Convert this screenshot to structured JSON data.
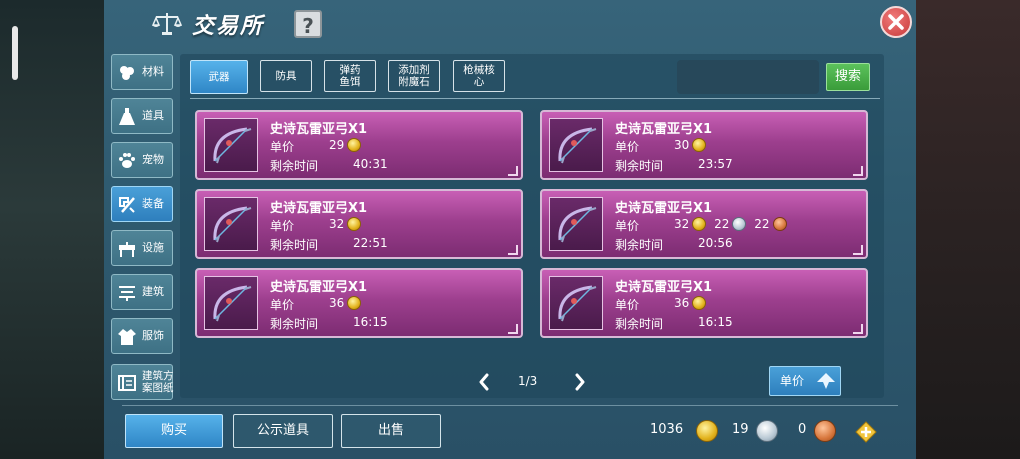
{
  "window": {
    "title": "交易所",
    "help_label": "?"
  },
  "categories": [
    {
      "label": "材料",
      "icon": "materials-icon"
    },
    {
      "label": "道具",
      "icon": "potion-icon"
    },
    {
      "label": "宠物",
      "icon": "paw-icon"
    },
    {
      "label": "装备",
      "icon": "equipment-icon",
      "active": true
    },
    {
      "label": "设施",
      "icon": "facility-icon"
    },
    {
      "label": "建筑",
      "icon": "building-icon"
    },
    {
      "label": "服饰",
      "icon": "clothing-icon"
    },
    {
      "label_line1": "建筑方",
      "label_line2": "案图纸",
      "icon": "blueprint-icon"
    }
  ],
  "subtabs": [
    {
      "label": "武器",
      "active": true
    },
    {
      "label": "防具"
    },
    {
      "label_line1": "弹药",
      "label_line2": "鱼饵"
    },
    {
      "label_line1": "添加剂",
      "label_line2": "附魔石"
    },
    {
      "label_line1": "枪械核",
      "label_line2": "心"
    }
  ],
  "search": {
    "button_label": "搜索",
    "value": ""
  },
  "field_labels": {
    "price": "单价",
    "time_left": "剩余时间"
  },
  "listings": [
    {
      "name": "史诗瓦雷亚弓X1",
      "gold": "29",
      "time_left": "40:31"
    },
    {
      "name": "史诗瓦雷亚弓X1",
      "gold": "30",
      "time_left": "23:57"
    },
    {
      "name": "史诗瓦雷亚弓X1",
      "gold": "32",
      "time_left": "22:51"
    },
    {
      "name": "史诗瓦雷亚弓X1",
      "gold": "32",
      "silver": "22",
      "bronze": "22",
      "time_left": "20:56"
    },
    {
      "name": "史诗瓦雷亚弓X1",
      "gold": "36",
      "time_left": "16:15"
    },
    {
      "name": "史诗瓦雷亚弓X1",
      "gold": "36",
      "time_left": "16:15"
    }
  ],
  "pager": {
    "text": "1/3"
  },
  "sort": {
    "label": "单价"
  },
  "actions": {
    "buy": "购买",
    "public_items": "公示道具",
    "sell": "出售"
  },
  "currency": {
    "gold": "1036",
    "silver": "19",
    "bronze": "0"
  },
  "colors": {
    "card_gradient_top": "#c85fb5",
    "card_gradient_bottom": "#7c2c72",
    "active_tab": "#2f86c6",
    "search_button": "#3a9c3a",
    "close_button": "#c83a3a"
  }
}
